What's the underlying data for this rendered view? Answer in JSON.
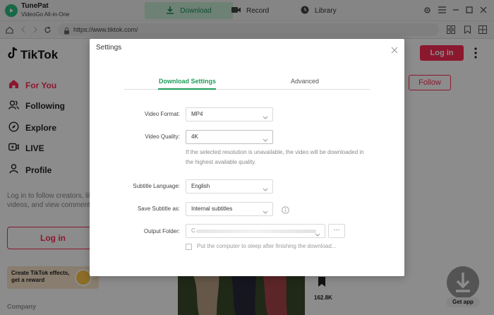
{
  "app": {
    "name": "TunePat",
    "subtitle": "VideoGo All-in-One",
    "tabs": [
      {
        "label": "Download",
        "icon": "download-icon",
        "active": true
      },
      {
        "label": "Record",
        "icon": "camera-icon",
        "active": false
      },
      {
        "label": "Library",
        "icon": "clock-icon",
        "active": false
      }
    ],
    "accent": "#1f9d58"
  },
  "browser": {
    "url": "https://www.tiktok.com/"
  },
  "tiktok": {
    "logo": "TikTok",
    "sidebar": [
      {
        "label": "For You",
        "icon": "home-icon",
        "active": true
      },
      {
        "label": "Following",
        "icon": "users-icon",
        "active": false
      },
      {
        "label": "Explore",
        "icon": "compass-icon",
        "active": false
      },
      {
        "label": "LIVE",
        "icon": "live-icon",
        "active": false
      },
      {
        "label": "Profile",
        "icon": "person-icon",
        "active": false
      }
    ],
    "login_note": "Log in to follow creators, like videos, and view comments.",
    "login_label": "Log in",
    "top_login_label": "Log in",
    "follow_label": "Follow",
    "promo_text": "Create TikTok effects, get a reward",
    "company_label": "Company",
    "video_count": "162.8K",
    "get_app_label": "Get app",
    "brand_color": "#fe2c55"
  },
  "settings": {
    "title": "Settings",
    "tabs": [
      {
        "label": "Download Settings",
        "active": true
      },
      {
        "label": "Advanced",
        "active": false
      }
    ],
    "video_format": {
      "label": "Video Format:",
      "value": "MP4"
    },
    "video_quality": {
      "label": "Video Quality:",
      "value": "4K"
    },
    "quality_hint": "If the selected resolution is unavailable, the video will be downloaded in the highest available quality.",
    "subtitle_language": {
      "label": "Subtitle Language:",
      "value": "English"
    },
    "save_subtitle": {
      "label": "Save Subtitle as:",
      "value": "Internal subtitles"
    },
    "output_folder": {
      "label": "Output Folder:",
      "value": "C"
    },
    "more_label": "···",
    "sleep_option": {
      "label": "Put the computer to sleep after finishing the download...",
      "checked": false
    }
  }
}
